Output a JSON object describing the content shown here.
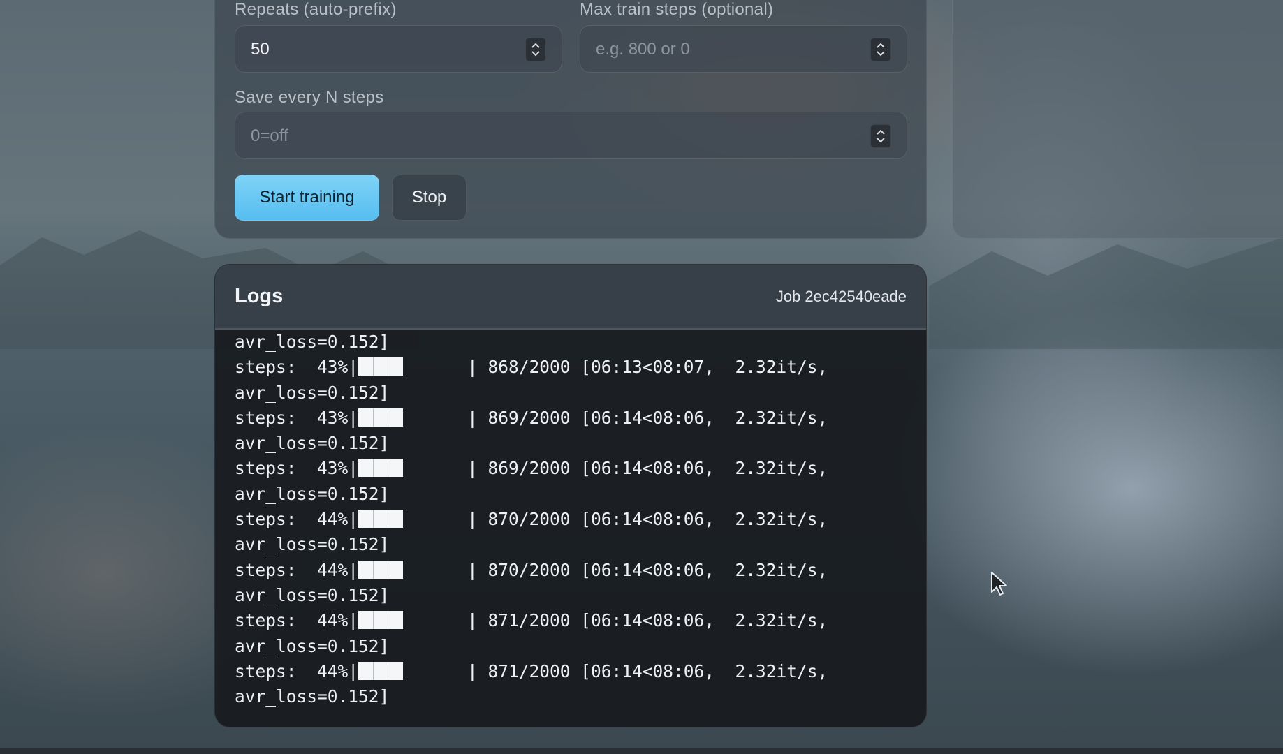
{
  "form": {
    "repeats": {
      "label": "Repeats (auto-prefix)",
      "value": "50",
      "placeholder": ""
    },
    "max_train_steps": {
      "label": "Max train steps (optional)",
      "value": "",
      "placeholder": "e.g. 800 or 0"
    },
    "save_every": {
      "label": "Save every N steps",
      "value": "",
      "placeholder": "0=off"
    },
    "start_label": "Start training",
    "stop_label": "Stop"
  },
  "logs": {
    "title": "Logs",
    "job": "Job 2ec42540eade",
    "lines": [
      {
        "kind": "loss",
        "text": "avr_loss=0.152]"
      },
      {
        "kind": "step",
        "prefix": "steps:  43%|",
        "suffix": "| 868/2000 [06:13<08:07,  2.32it/s,"
      },
      {
        "kind": "loss",
        "text": "avr_loss=0.152]"
      },
      {
        "kind": "step",
        "prefix": "steps:  43%|",
        "suffix": "| 869/2000 [06:14<08:06,  2.32it/s,"
      },
      {
        "kind": "loss",
        "text": "avr_loss=0.152]"
      },
      {
        "kind": "step",
        "prefix": "steps:  43%|",
        "suffix": "| 869/2000 [06:14<08:06,  2.32it/s,"
      },
      {
        "kind": "loss",
        "text": "avr_loss=0.152]"
      },
      {
        "kind": "step",
        "prefix": "steps:  44%|",
        "suffix": "| 870/2000 [06:14<08:06,  2.32it/s,"
      },
      {
        "kind": "loss",
        "text": "avr_loss=0.152]"
      },
      {
        "kind": "step",
        "prefix": "steps:  44%|",
        "suffix": "| 870/2000 [06:14<08:06,  2.32it/s,"
      },
      {
        "kind": "loss",
        "text": "avr_loss=0.152]"
      },
      {
        "kind": "step",
        "prefix": "steps:  44%|",
        "suffix": "| 871/2000 [06:14<08:06,  2.32it/s,"
      },
      {
        "kind": "loss",
        "text": "avr_loss=0.152]"
      },
      {
        "kind": "step",
        "prefix": "steps:  44%|",
        "suffix": "| 871/2000 [06:14<08:06,  2.32it/s,"
      },
      {
        "kind": "loss",
        "text": "avr_loss=0.152]"
      }
    ]
  },
  "colors": {
    "primary_button": "#56bdf0",
    "log_background": "#181b1f"
  }
}
